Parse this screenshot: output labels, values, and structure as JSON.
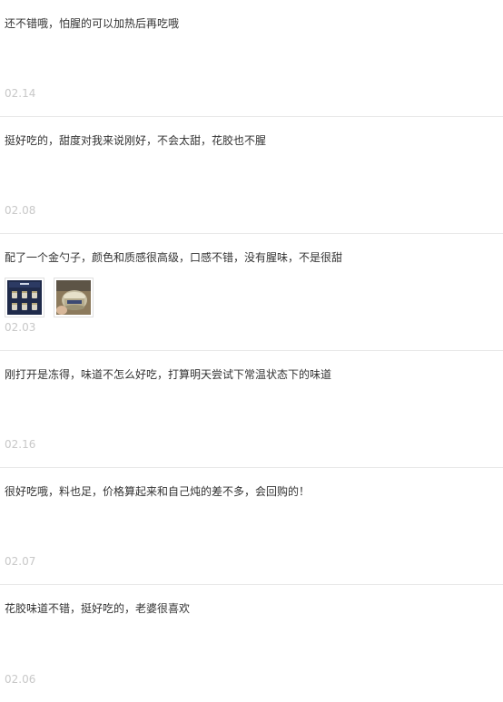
{
  "reviews": [
    {
      "text": "还不错哦，怕腥的可以加热后再吃哦",
      "date": "02.14"
    },
    {
      "text": "挺好吃的，甜度对我来说刚好，不会太甜，花胶也不腥",
      "date": "02.08"
    },
    {
      "text": "配了一个金勺子，颜色和质感很高级，口感不错，没有腥味，不是很甜",
      "date": "02.03",
      "photos": [
        "gift-box-photo",
        "jar-photo"
      ]
    },
    {
      "text": "刚打开是冻得，味道不怎么好吃，打算明天尝试下常温状态下的味道",
      "date": "02.16"
    },
    {
      "text": "很好吃哦，料也足，价格算起来和自己炖的差不多，会回购的！",
      "date": "02.07"
    },
    {
      "text": "花胶味道不错，挺好吃的，老婆很喜欢",
      "date": "02.06"
    }
  ]
}
